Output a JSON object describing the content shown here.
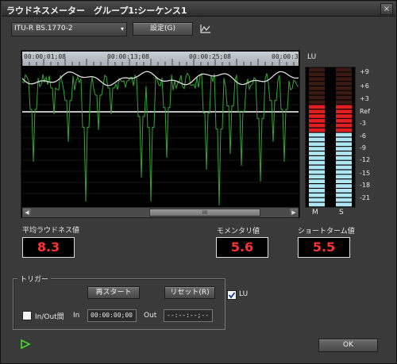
{
  "window": {
    "title": "ラウドネスメーター　グループ1:シーケンス1",
    "close_label": "×"
  },
  "toolbar": {
    "standard_select": {
      "value": "ITU-R BS.1770-2",
      "arrow": "▾"
    },
    "settings_label": "設定(G)",
    "graph_icon": "line-graph-icon"
  },
  "graph": {
    "timecodes": [
      "00:00:01;08",
      "00:00:13;08",
      "00:00:25;08",
      "00:00:3"
    ],
    "scroll_thumb_grip": "III",
    "scroll_left": "◀",
    "scroll_right": "▶",
    "colors": {
      "short_term": "#2fa82f",
      "momentary_avg": "#dcdcdc",
      "reference": "#ffffff"
    }
  },
  "meters": {
    "title": "LU",
    "scale": [
      "+9",
      "+6",
      "+3",
      "Ref",
      "-3",
      "-6",
      "-9",
      "-12",
      "-15",
      "-18",
      "-21"
    ],
    "channel_labels": [
      "M",
      "S"
    ],
    "colors": {
      "over": "#e02020",
      "normal": "#aee6f2",
      "off": "#3a1a12"
    }
  },
  "readouts": {
    "integrated": {
      "label": "平均ラウドネス値",
      "value": "8.3"
    },
    "momentary": {
      "label": "モメンタリ値",
      "value": "5.6"
    },
    "short_term": {
      "label": "ショートターム値",
      "value": "5.5"
    }
  },
  "trigger": {
    "group_label": "トリガー",
    "restart_label": "再スタート",
    "reset_label": "リセット(R)",
    "inout_label": "In/Out間",
    "in_label": "In",
    "in_value": "00:00:00;00",
    "out_label": "Out",
    "out_value": "--:--:--;--"
  },
  "lu_checkbox": {
    "label": "LU",
    "checked": true
  },
  "footer": {
    "ok_label": "OK",
    "play_icon": "play-icon"
  }
}
